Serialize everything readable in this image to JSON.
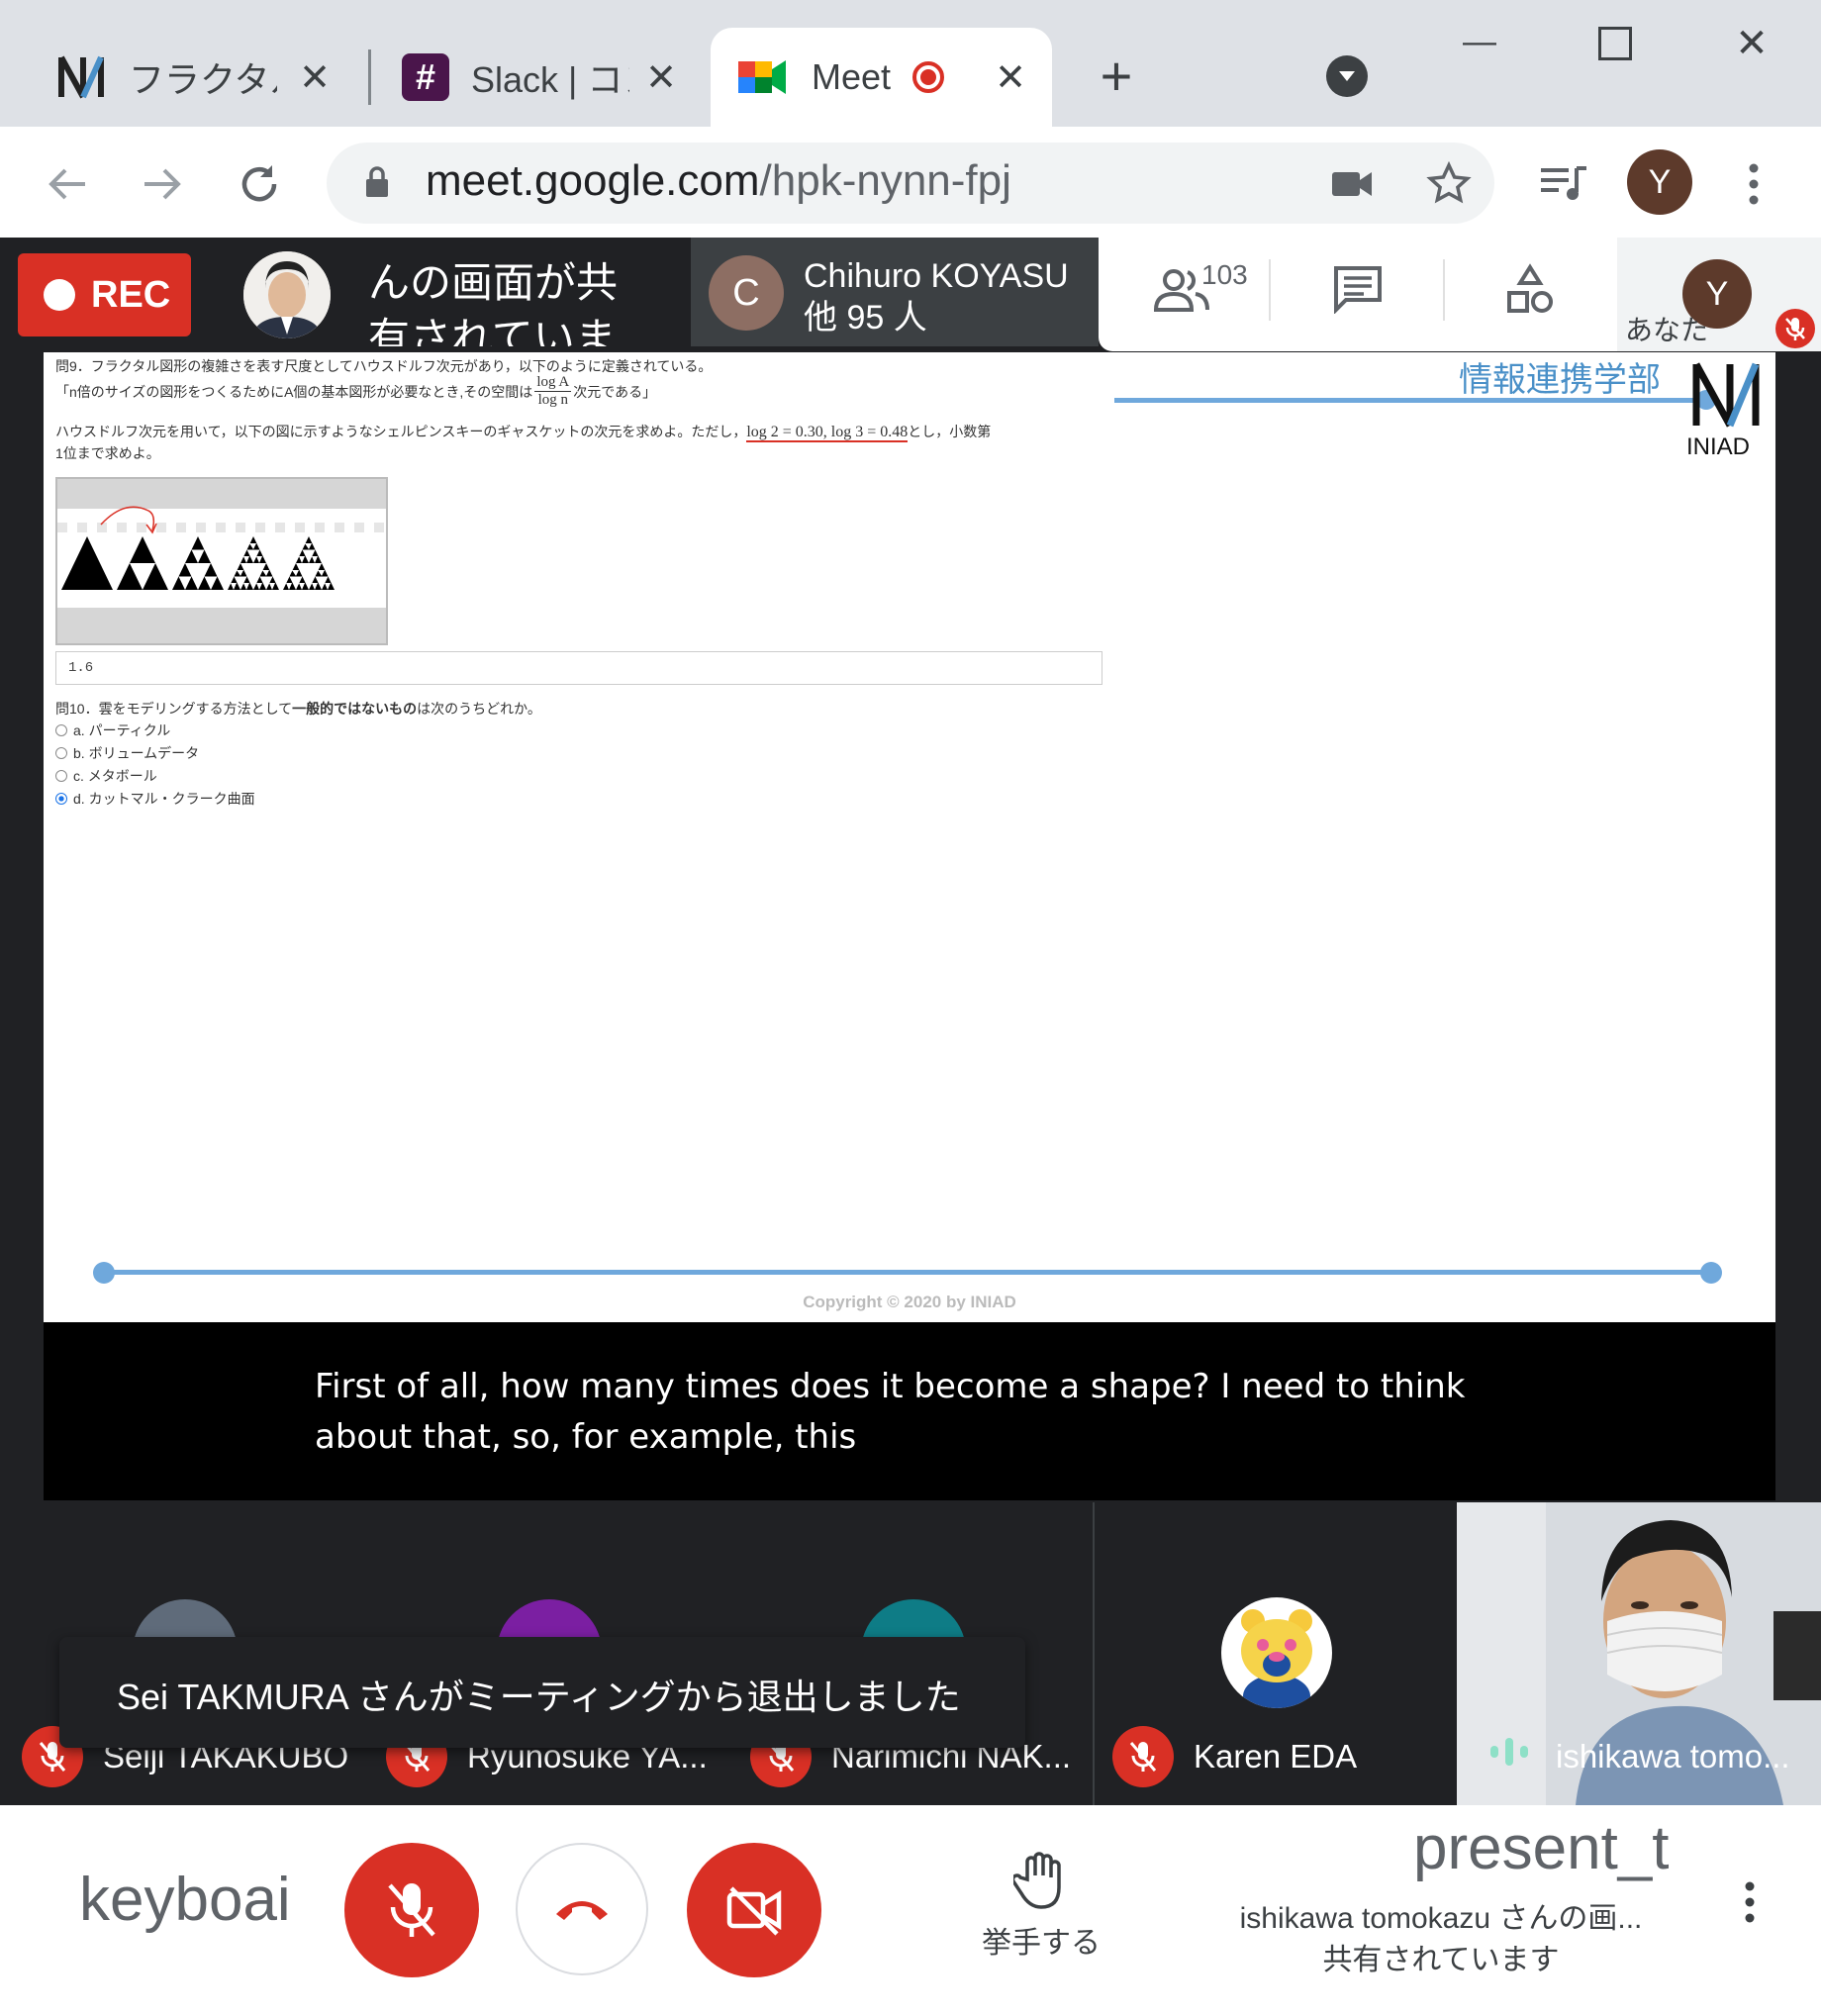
{
  "browser": {
    "tabs": [
      {
        "title": "フラクタルの",
        "close": "✕"
      },
      {
        "title": "Slack | コン",
        "close": "✕"
      },
      {
        "title": "Meet",
        "close": "✕"
      }
    ],
    "new_tab": "+",
    "url_host": "meet.google.com",
    "url_path": "/hpk-nynn-fpj",
    "profile_initial": "Y",
    "window_controls": {
      "minimize": "—",
      "maximize": "☐",
      "close": "✕"
    }
  },
  "meet": {
    "rec_label": "REC",
    "presenter_text_line1": "んの画面が共",
    "presenter_text_line2": "有されていま",
    "participant_initial": "C",
    "participant_name": "Chihuro KOYASU",
    "participant_others": "他 95 人",
    "people_count": "103",
    "self_initial": "Y",
    "self_label": "あなた",
    "caption": "First of all, how many times does it become a shape? I need to think about that, so, for example, this",
    "toast": "Sei TAKMURA さんがミーティングから退出しました",
    "tiles": [
      {
        "name": "Seiji TAKAKUBO",
        "muted": true,
        "color": "#5f6b7a"
      },
      {
        "name": "Ryunosuke YA...",
        "muted": true,
        "color": "#7b1fa2"
      },
      {
        "name": "Narimichi NAK...",
        "muted": true,
        "color": "#0e7c86"
      },
      {
        "name": "Karen EDA",
        "muted": true
      },
      {
        "name": "ishikawa tomo...",
        "muted": false
      }
    ],
    "bottom": {
      "keyboard_text": "keyboai",
      "raise_hand_label": "挙手する",
      "present_text": "present_t",
      "presenting_line1": "ishikawa tomokazu さんの画...",
      "presenting_line2": "共有されています"
    }
  },
  "slide": {
    "q9_title": "問9．フラクタル図形の複雑さを表す尺度としてハウスドルフ次元があり，以下のように定義されている。",
    "q9_def_pre": "「n倍のサイズの図形をつくるためにA個の基本図形が必要なとき,その空間は",
    "q9_frac_num": "log A",
    "q9_frac_den": "log n",
    "q9_def_post": "次元である」",
    "q9_body_pre": "ハウスドルフ次元を用いて，以下の図に示すようなシェルピンスキーのギャスケットの次元を求めよ。ただし，",
    "q9_given": "log 2 = 0.30,  log 3 = 0.48",
    "q9_body_post": "とし，小数第",
    "q9_body_line2": "1位まで求めよ。",
    "answer_value": "1.6",
    "q10_pre": "問10．雲をモデリングする方法として",
    "q10_bold": "一般的ではないもの",
    "q10_post": "は次のうちどれか。",
    "options": [
      {
        "label": "a. パーティクル",
        "selected": false
      },
      {
        "label": "b. ボリュームデータ",
        "selected": false
      },
      {
        "label": "c. メタボール",
        "selected": false
      },
      {
        "label": "d. カットマル・クラーク曲面",
        "selected": true
      }
    ],
    "dept_label": "情報連携学部",
    "logo_text": "INIAD",
    "copyright": "Copyright © 2020 by INIAD"
  },
  "colors": {
    "meet_red": "#d93025",
    "accent_blue": "#6fa8dc",
    "tile_bg": "#202124"
  }
}
